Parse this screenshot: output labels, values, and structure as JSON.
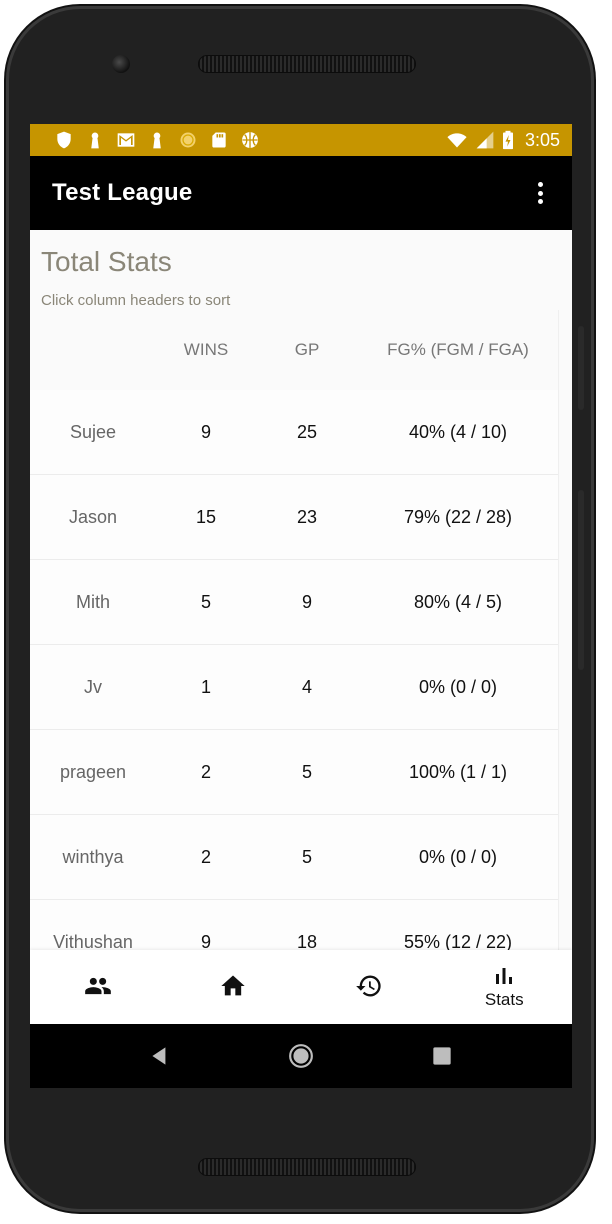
{
  "status_bar": {
    "time": "3:05",
    "background_color": "#c69500",
    "left_icons": [
      "shield-icon",
      "keyhole-icon",
      "gmail-icon",
      "keyhole-icon",
      "coin-icon",
      "sd-card-icon",
      "basketball-icon"
    ],
    "right_icons": [
      "wifi-icon",
      "cell-signal-icon",
      "battery-charging-icon"
    ]
  },
  "app_bar": {
    "title": "Test League",
    "overflow_icon": "more-vert-icon"
  },
  "content": {
    "title": "Total Stats",
    "hint": "Click column headers to sort",
    "columns": [
      "",
      "WINS",
      "GP",
      "FG% (FGM / FGA)"
    ],
    "rows": [
      {
        "name": "Sujee",
        "wins": "9",
        "gp": "25",
        "fg": "40% (4 / 10)"
      },
      {
        "name": "Jason",
        "wins": "15",
        "gp": "23",
        "fg": "79% (22 / 28)"
      },
      {
        "name": "Mith",
        "wins": "5",
        "gp": "9",
        "fg": "80% (4 / 5)"
      },
      {
        "name": "Jv",
        "wins": "1",
        "gp": "4",
        "fg": "0% (0 / 0)"
      },
      {
        "name": "prageen",
        "wins": "2",
        "gp": "5",
        "fg": "100% (1 / 1)"
      },
      {
        "name": "winthya",
        "wins": "2",
        "gp": "5",
        "fg": "0% (0 / 0)"
      },
      {
        "name": "Vithushan",
        "wins": "9",
        "gp": "18",
        "fg": "55% (12 / 22)"
      }
    ]
  },
  "bottom_nav": {
    "items": [
      {
        "icon": "people-icon",
        "label": ""
      },
      {
        "icon": "home-icon",
        "label": ""
      },
      {
        "icon": "history-icon",
        "label": ""
      },
      {
        "icon": "bar-chart-icon",
        "label": "Stats"
      }
    ]
  },
  "system_nav": {
    "icons": [
      "back-icon",
      "home-circle-icon",
      "recents-icon"
    ]
  }
}
